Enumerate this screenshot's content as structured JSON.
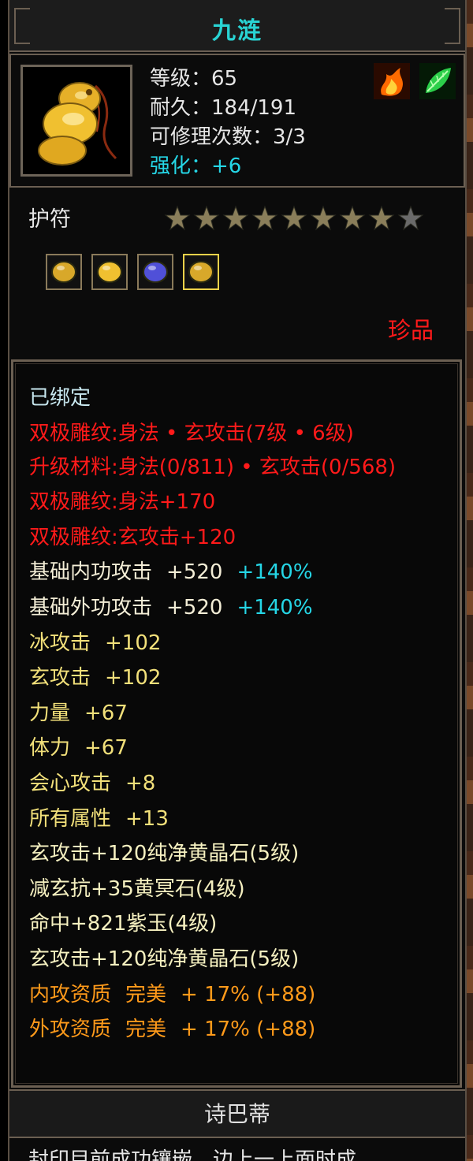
{
  "item": {
    "name": "九涟",
    "level": "等级：65",
    "durability": "耐久：184/191",
    "repairs": "可修理次数：3/3",
    "enhance": "强化：+6",
    "type": "护符",
    "stars_total": 9,
    "stars_filled": 8,
    "quality": "珍品"
  },
  "badges": [
    "fire-icon",
    "leaf-icon"
  ],
  "gems": [
    {
      "name": "yellow-gem-icon",
      "color": "#d8a82a"
    },
    {
      "name": "gold-gem-icon",
      "color": "#f0c030"
    },
    {
      "name": "purple-gem-icon",
      "color": "#5050d8"
    },
    {
      "name": "yellow-gem-icon",
      "color": "#d8a82a"
    }
  ],
  "attributes": {
    "bound": "已绑定",
    "carve1": "双极雕纹:身法 • 玄攻击(7级 • 6级)",
    "upgrade": "升级材料:身法(0/811) • 玄攻击(0/568)",
    "carve2": "双极雕纹:身法+170",
    "carve3": "双极雕纹:玄攻击+120",
    "inner_attack": {
      "label": "基础内功攻击",
      "value": "+520",
      "pct": "+140%"
    },
    "outer_attack": {
      "label": "基础外功攻击",
      "value": "+520",
      "pct": "+140%"
    },
    "ice_attack": {
      "label": "冰攻击",
      "value": "+102"
    },
    "xuan_attack": {
      "label": "玄攻击",
      "value": "+102"
    },
    "strength": {
      "label": "力量",
      "value": "+67"
    },
    "stamina": {
      "label": "体力",
      "value": "+67"
    },
    "crit": {
      "label": "会心攻击",
      "value": "+8"
    },
    "all_attr": {
      "label": "所有属性",
      "value": "+13"
    },
    "gem1": "玄攻击+120纯净黄晶石(5级)",
    "gem2": "减玄抗+35黄冥石(4级)",
    "gem3": "命中+821紫玉(4级)",
    "gem4": "玄攻击+120纯净黄晶石(5级)",
    "inner_quality": {
      "label": "内攻资质",
      "grade": "完美",
      "value": "+ 17% (+88)"
    },
    "outer_quality": {
      "label": "外攻资质",
      "grade": "完美",
      "value": "+ 17% (+88)"
    }
  },
  "footer": {
    "set_name": "诗巴蒂",
    "cut_line": "封印目前成功镶嵌。边上一上面时成"
  },
  "colors": {
    "title": "#29d4d4",
    "red": "#ff1a1a",
    "yellow": "#f2e07a",
    "orange": "#ff9a1a",
    "cyan": "#25d6e6",
    "star_filled": "#8a7e5a",
    "star_empty": "#6a6a6a"
  }
}
